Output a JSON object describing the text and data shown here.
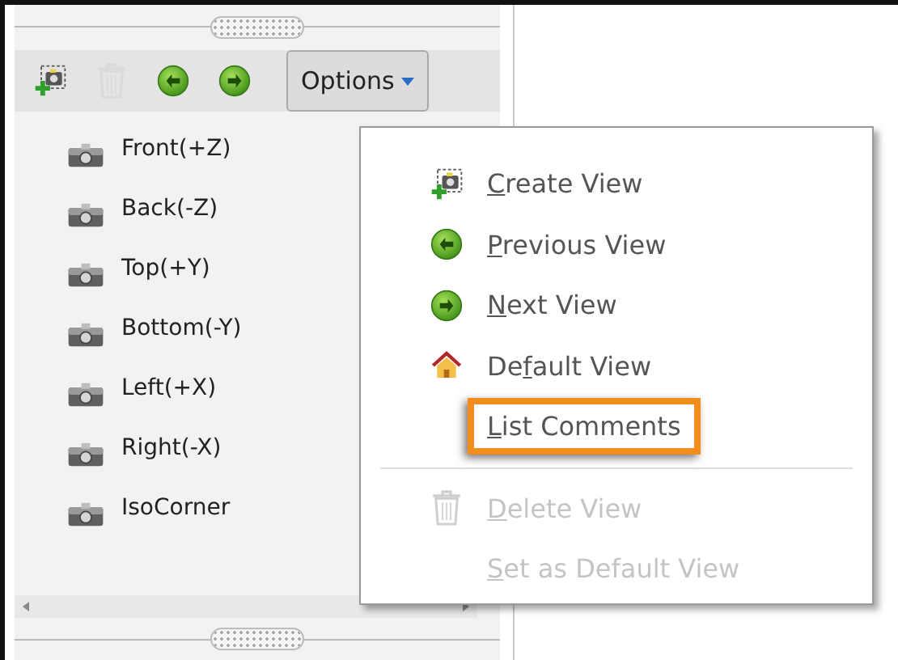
{
  "toolbar": [
    {
      "kind": "create",
      "disabled": false
    },
    {
      "kind": "delete",
      "disabled": true
    },
    {
      "kind": "previous",
      "disabled": false
    },
    {
      "kind": "next",
      "disabled": false
    }
  ],
  "options_button": {
    "label": "Options",
    "pressed": true
  },
  "views": [
    {
      "label": "Front(+Z)"
    },
    {
      "label": "Back(-Z)"
    },
    {
      "label": "Top(+Y)"
    },
    {
      "label": "Bottom(-Y)"
    },
    {
      "label": "Left(+X)"
    },
    {
      "label": "Right(-X)"
    },
    {
      "label": "IsoCorner"
    }
  ],
  "menu": [
    {
      "kind": "create",
      "access_key": "C",
      "label_after": "reate View",
      "disabled": false,
      "highlighted": false
    },
    {
      "kind": "previous",
      "access_key": "P",
      "label_after": "revious View",
      "disabled": false,
      "highlighted": false
    },
    {
      "kind": "next",
      "access_key": "N",
      "label_after": "ext View",
      "disabled": false,
      "highlighted": false
    },
    {
      "kind": "home",
      "label_before": "De",
      "access_key": "f",
      "label_after": "ault View",
      "disabled": false,
      "highlighted": false
    },
    {
      "kind": "plain",
      "access_key": "L",
      "label_after": "ist Comments",
      "disabled": false,
      "highlighted": true
    },
    {
      "kind": "separator"
    },
    {
      "kind": "delete",
      "access_key": "D",
      "label_after": "elete View",
      "disabled": true,
      "highlighted": false
    },
    {
      "kind": "plain",
      "access_key": "S",
      "label_after": "et as Default View",
      "disabled": true,
      "highlighted": false
    }
  ]
}
